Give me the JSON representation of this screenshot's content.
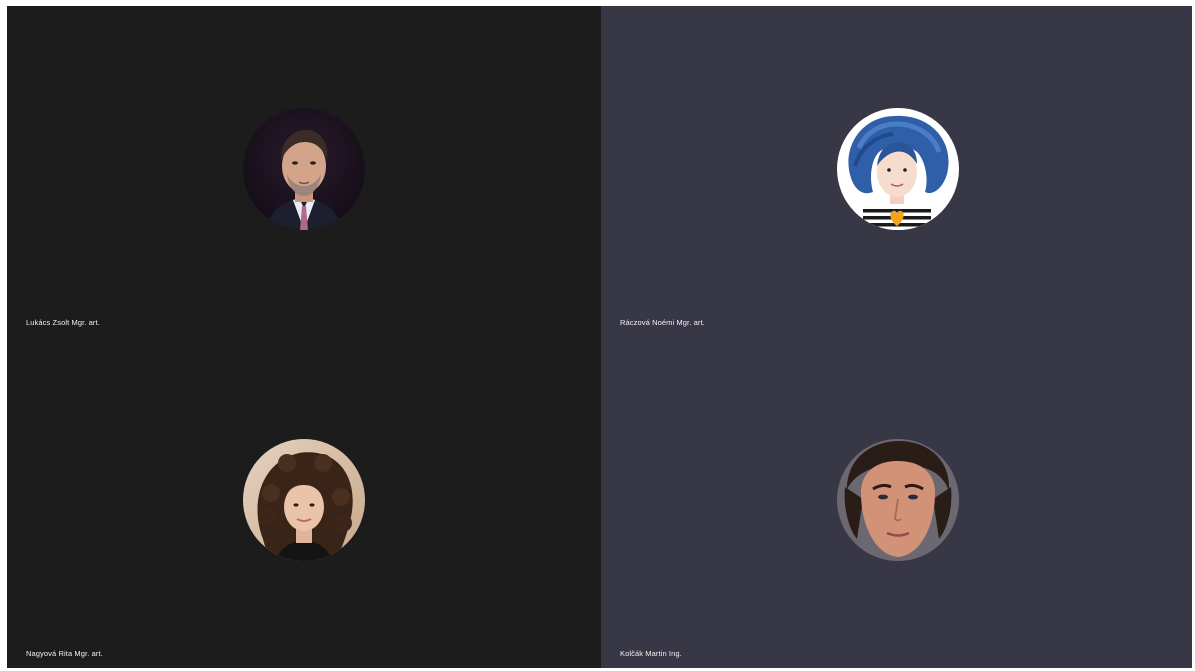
{
  "meeting": {
    "participants": [
      {
        "name": "Lukács Zsolt Mgr. art.",
        "avatar": "man-suit-photo-avatar",
        "tile_color": "#1c1c1c"
      },
      {
        "name": "Ráczová Noémi Mgr. art.",
        "avatar": "blue-hair-illustration-avatar",
        "tile_color": "#383746"
      },
      {
        "name": "Nagyová Rita Mgr. art.",
        "avatar": "curly-hair-woman-photo-avatar",
        "tile_color": "#1c1c1c"
      },
      {
        "name": "Kolčák Martin Ing.",
        "avatar": "man-face-photo-avatar",
        "tile_color": "#383746"
      }
    ]
  }
}
